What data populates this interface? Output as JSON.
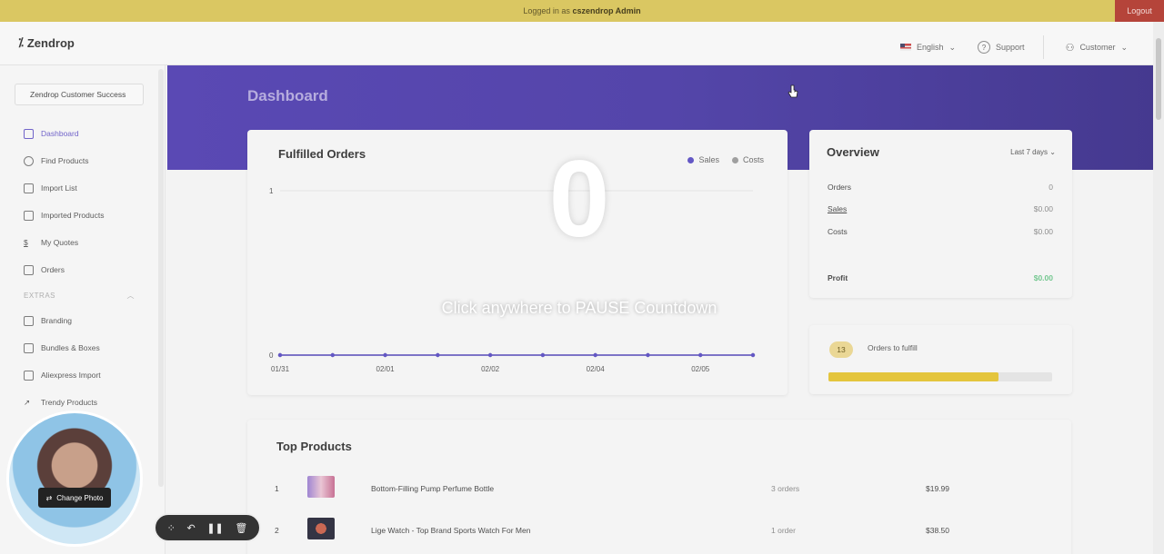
{
  "banner": {
    "prefix": "Logged in as",
    "user": "cszendrop Admin",
    "logout": "Logout"
  },
  "header": {
    "logo": "Zendrop",
    "language": "English",
    "support": "Support",
    "account": "Customer"
  },
  "sidebar": {
    "account_selector": "Zendrop Customer Success",
    "items": [
      {
        "label": "Dashboard",
        "icon": "bar-chart-icon"
      },
      {
        "label": "Find Products",
        "icon": "search-icon"
      },
      {
        "label": "Import List",
        "icon": "import-icon"
      },
      {
        "label": "Imported Products",
        "icon": "box-icon"
      },
      {
        "label": "My Quotes",
        "icon": "dollar-icon"
      },
      {
        "label": "Orders",
        "icon": "clipboard-icon"
      }
    ],
    "extras_label": "EXTRAS",
    "extras": [
      {
        "label": "Branding",
        "icon": "brush-icon"
      },
      {
        "label": "Bundles & Boxes",
        "icon": "box-icon"
      },
      {
        "label": "Aliexpress Import",
        "icon": "import-icon"
      },
      {
        "label": "Trendy Products",
        "icon": "trend-icon"
      }
    ]
  },
  "page": {
    "title": "Dashboard"
  },
  "fulfilled": {
    "title": "Fulfilled Orders",
    "legend": [
      {
        "name": "Sales",
        "color": "#5b4ec2"
      },
      {
        "name": "Costs",
        "color": "#9a9a9a"
      }
    ]
  },
  "chart_data": {
    "type": "line",
    "title": "Fulfilled Orders",
    "x": [
      "01/31",
      "",
      "02/01",
      "",
      "02/02",
      "",
      "02/04",
      "",
      "02/05",
      ""
    ],
    "series": [
      {
        "name": "Sales",
        "values": [
          0,
          0,
          0,
          0,
          0,
          0,
          0,
          0,
          0,
          0
        ]
      },
      {
        "name": "Costs",
        "values": [
          0,
          0,
          0,
          0,
          0,
          0,
          0,
          0,
          0,
          0
        ]
      }
    ],
    "ylim": [
      0,
      1
    ],
    "yticks": [
      "0",
      "1"
    ]
  },
  "overview": {
    "title": "Overview",
    "range": "Last 7 days",
    "rows": [
      {
        "label": "Orders",
        "value": "0"
      },
      {
        "label": "Sales",
        "value": "$0.00"
      },
      {
        "label": "Costs",
        "value": "$0.00"
      }
    ],
    "profit_label": "Profit",
    "profit_value": "$0.00"
  },
  "to_fulfill": {
    "count": "13",
    "label": "Orders to fulfill",
    "progress": 0.76
  },
  "top_products": {
    "title": "Top Products",
    "rows": [
      {
        "rank": "1",
        "name": "Bottom-Filling Pump Perfume Bottle",
        "orders": "3 orders",
        "price": "$19.99"
      },
      {
        "rank": "2",
        "name": "Lige Watch - Top Brand Sports Watch For Men",
        "orders": "1 order",
        "price": "$38.50"
      }
    ]
  },
  "overlay": {
    "countdown": "0",
    "message": "Click anywhere to PAUSE Countdown"
  },
  "recorder": {
    "change_photo": "Change Photo"
  }
}
